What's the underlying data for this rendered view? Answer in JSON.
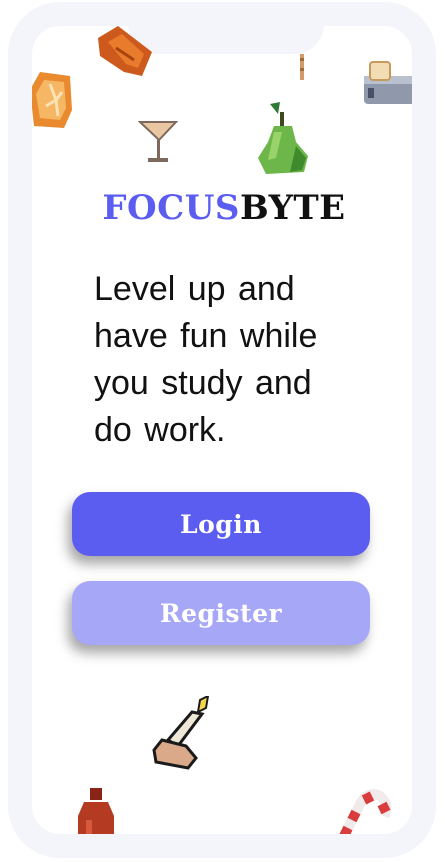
{
  "brand": {
    "part1": "FOCUS",
    "part2": "BYTE",
    "color_part1": "#5b5cf0",
    "color_part2": "#111111"
  },
  "tagline": "Level up and have fun while you study and do work.",
  "buttons": {
    "login_label": "Login",
    "register_label": "Register",
    "login_color": "#5b5cf0",
    "register_color": "#a6a7f7"
  },
  "decorations": [
    "orange-slice-icon",
    "croissant-icon",
    "toast-icon",
    "cocktail-glass-icon",
    "pear-icon",
    "candle-icon",
    "bottle-icon",
    "candy-cane-icon",
    "stick-icon"
  ]
}
